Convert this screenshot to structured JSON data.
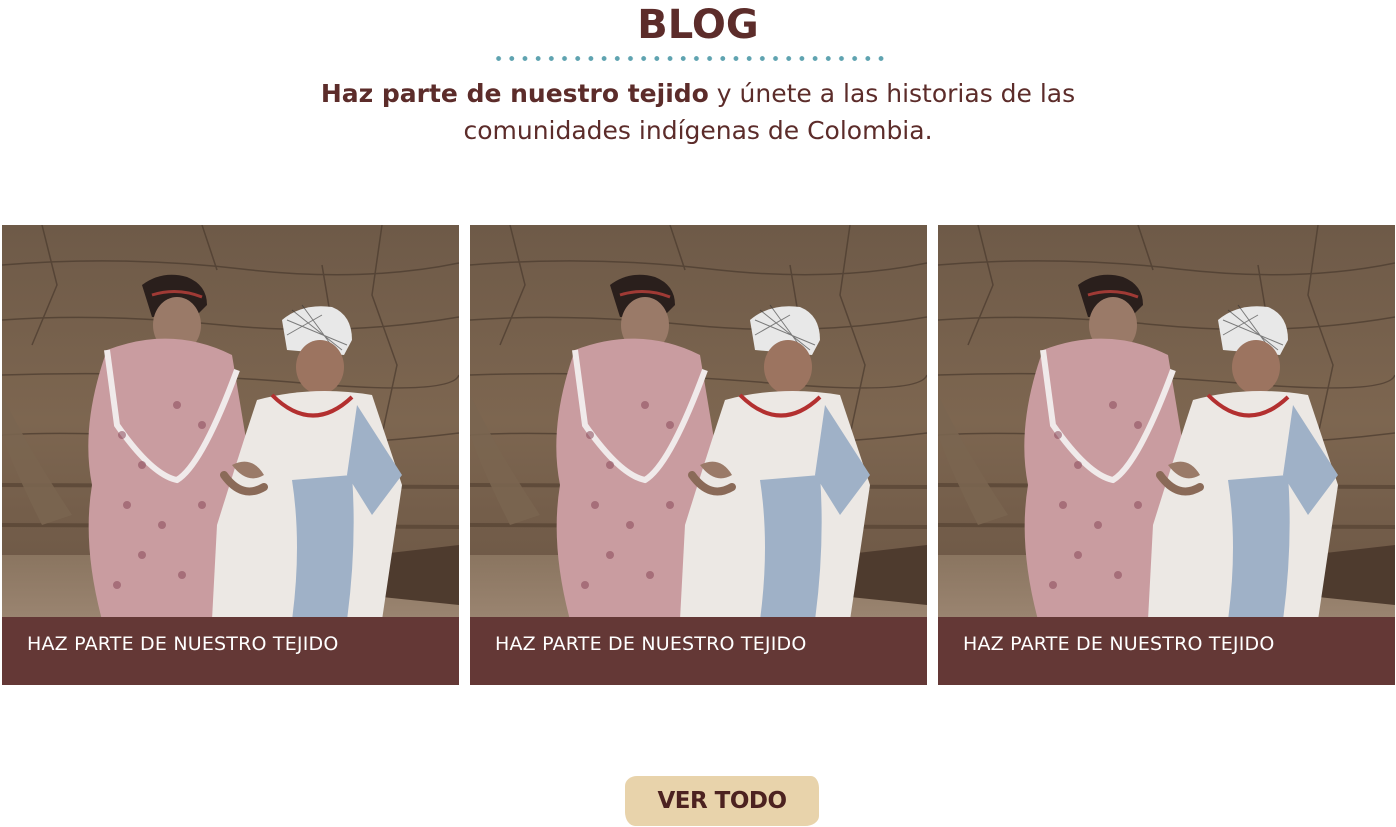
{
  "header": {
    "title": "Blog",
    "intro_strong": "Haz parte de nuestro tejido",
    "intro_rest": " y únete a las historias de las comunidades indígenas de Colombia."
  },
  "cards": [
    {
      "caption": "HAZ PARTE DE NUESTRO TEJIDO",
      "image": "two-indigenous-women-photo"
    },
    {
      "caption": "HAZ PARTE DE NUESTRO TEJIDO",
      "image": "two-indigenous-women-photo"
    },
    {
      "caption": "HAZ PARTE DE NUESTRO TEJIDO",
      "image": "two-indigenous-women-photo"
    }
  ],
  "footer": {
    "button_label": "Ver todo"
  },
  "colors": {
    "brand_brown": "#5c2c2a",
    "caption_bar": "#643836",
    "accent_dots": "#5fa3b0",
    "button_bg": "#e8d3ab"
  }
}
